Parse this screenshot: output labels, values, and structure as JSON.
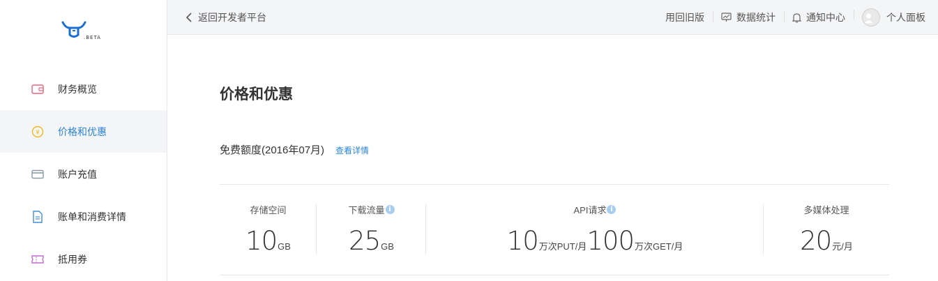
{
  "logo": {
    "badge_text": ".BETA"
  },
  "sidebar": {
    "items": [
      {
        "label": "财务概览",
        "icon": "wallet-icon",
        "color": "#e8647a",
        "active": false
      },
      {
        "label": "价格和优惠",
        "icon": "yen-coin-icon",
        "color": "#f0b91b",
        "active": true
      },
      {
        "label": "账户充值",
        "icon": "card-icon",
        "color": "#8a9aa8",
        "active": false
      },
      {
        "label": "账单和消费详情",
        "icon": "bill-icon",
        "color": "#3f8fd8",
        "active": false
      },
      {
        "label": "抵用券",
        "icon": "coupon-icon",
        "color": "#c46ad9",
        "active": false
      }
    ]
  },
  "topbar": {
    "back_label": "返回开发者平台",
    "old_version": "用回旧版",
    "stats": "数据统计",
    "notifications": "通知中心",
    "profile": "个人面板"
  },
  "main": {
    "title": "价格和优惠",
    "quota_title": "免费额度(2016年07月)",
    "quota_link": "查看详情",
    "stats": [
      {
        "label": "存储空间",
        "info": false,
        "values": [
          {
            "num": "10",
            "unit": "GB"
          }
        ]
      },
      {
        "label": "下载流量",
        "info": true,
        "values": [
          {
            "num": "25",
            "unit": "GB"
          }
        ]
      },
      {
        "label": "API请求",
        "info": true,
        "values": [
          {
            "num": "10",
            "unit": "万次PUT/月"
          },
          {
            "num": "100",
            "unit": "万次GET/月"
          }
        ]
      },
      {
        "label": "多媒体处理",
        "info": false,
        "values": [
          {
            "num": "20",
            "unit": "元/月"
          }
        ]
      }
    ]
  },
  "colors": {
    "accent": "#2b84d9",
    "active_bg": "#f4f5f7"
  }
}
